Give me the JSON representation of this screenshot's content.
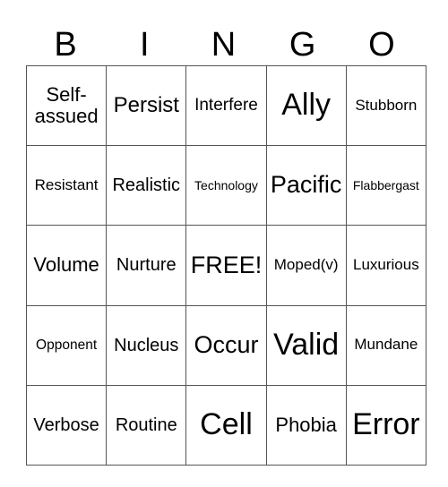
{
  "title_letters": [
    "B",
    "I",
    "N",
    "G",
    "O"
  ],
  "rows": [
    [
      "Self-assued",
      "Persist",
      "Interfere",
      "Ally",
      "Stubborn"
    ],
    [
      "Resistant",
      "Realistic",
      "Technology",
      "Pacific",
      "Flabbergast"
    ],
    [
      "Volume",
      "Nurture",
      "FREE!",
      "Moped(v)",
      "Luxurious"
    ],
    [
      "Opponent",
      "Nucleus",
      "Occur",
      "Valid",
      "Mundane"
    ],
    [
      "Verbose",
      "Routine",
      "Cell",
      "Phobia",
      "Error"
    ]
  ]
}
